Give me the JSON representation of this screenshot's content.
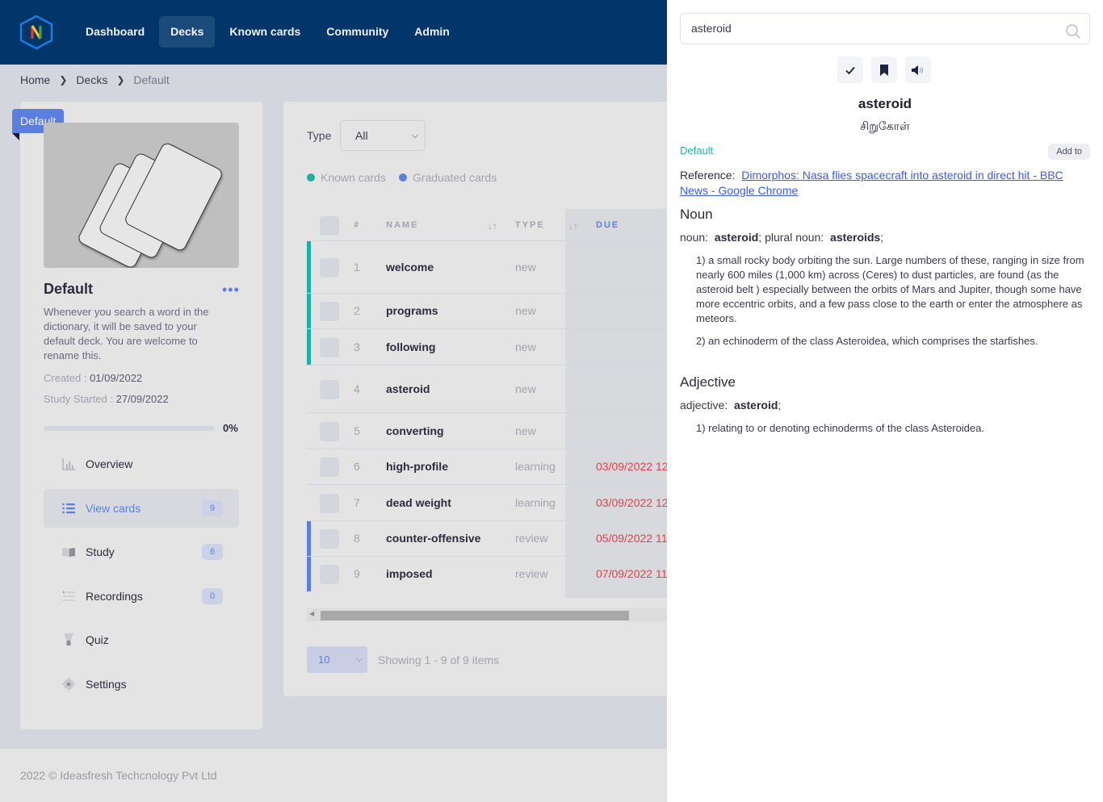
{
  "nav": {
    "logo_letter": "N",
    "items": [
      {
        "label": "Dashboard",
        "active": false
      },
      {
        "label": "Decks",
        "active": true
      },
      {
        "label": "Known cards",
        "active": false
      },
      {
        "label": "Community",
        "active": false
      },
      {
        "label": "Admin",
        "active": false
      }
    ]
  },
  "breadcrumb": [
    "Home",
    "Decks",
    "Default"
  ],
  "deck": {
    "ribbon": "Default",
    "title": "Default",
    "more_icon": "ellipsis-icon",
    "description": "Whenever you search a word in the dictionary, it will be saved to your default deck. You are welcome to rename this.",
    "created_label": "Created : ",
    "created": "01/09/2022",
    "study_started_label": "Study Started : ",
    "study_started": "27/09/2022",
    "progress_percent": 0,
    "progress_label": "0%",
    "menu": [
      {
        "label": "Overview",
        "icon": "bar-chart-icon",
        "badge": null,
        "active": false
      },
      {
        "label": "View cards",
        "icon": "list-icon",
        "badge": "9",
        "active": true
      },
      {
        "label": "Study",
        "icon": "book-icon",
        "badge": "6",
        "active": false
      },
      {
        "label": "Recordings",
        "icon": "playlist-icon",
        "badge": "0",
        "active": false
      },
      {
        "label": "Quiz",
        "icon": "trophy-icon",
        "badge": null,
        "active": false
      },
      {
        "label": "Settings",
        "icon": "gear-icon",
        "badge": null,
        "active": false
      }
    ]
  },
  "cards": {
    "filter_label": "Type",
    "filter_value": "All",
    "legend": [
      {
        "label": "Known cards",
        "color": "#1bb0a2"
      },
      {
        "label": "Graduated cards",
        "color": "#5b7fe0"
      }
    ],
    "columns": [
      "#",
      "NAME",
      "TYPE",
      "DUE"
    ],
    "rows": [
      {
        "num": "1",
        "name": "welcome",
        "type": "new",
        "due": "",
        "marker": "known"
      },
      {
        "num": "2",
        "name": "programs",
        "type": "new",
        "due": "",
        "marker": "known"
      },
      {
        "num": "3",
        "name": "following",
        "type": "new",
        "due": "",
        "marker": "known"
      },
      {
        "num": "4",
        "name": "asteroid",
        "type": "new",
        "due": "",
        "marker": ""
      },
      {
        "num": "5",
        "name": "converting",
        "type": "new",
        "due": "",
        "marker": ""
      },
      {
        "num": "6",
        "name": "high-profile",
        "type": "learning",
        "due": "03/09/2022 12",
        "marker": ""
      },
      {
        "num": "7",
        "name": "dead weight",
        "type": "learning",
        "due": "03/09/2022 12",
        "marker": ""
      },
      {
        "num": "8",
        "name": "counter-offensive",
        "type": "review",
        "due": "05/09/2022 11",
        "marker": "graduated"
      },
      {
        "num": "9",
        "name": "imposed",
        "type": "review",
        "due": "07/09/2022 11",
        "marker": "graduated"
      }
    ],
    "page_size": "10",
    "showing": "Showing 1 - 9 of 9 items"
  },
  "footer": "2022 © Ideasfresh Techcnology Pvt Ltd",
  "dictionary": {
    "search_value": "asteroid",
    "actions": [
      "check-icon",
      "bookmark-icon",
      "speaker-icon"
    ],
    "word": "asteroid",
    "translation": "சிறுகோள்",
    "deck": "Default",
    "add_to": "Add to",
    "reference_label": "Reference:",
    "reference_link": "Dimorphos: Nasa flies spacecraft into asteroid in direct hit - BBC News - Google Chrome",
    "sections": [
      {
        "pos": "Noun",
        "forms_prefix": "noun:",
        "form1": "asteroid",
        "forms_mid": "; plural noun:",
        "form2": "asteroids",
        "definitions": [
          "1)  a small rocky body orbiting the sun. Large numbers of these, ranging in size from nearly 600 miles (1,000 km) across (Ceres) to dust particles, are found (as the asteroid belt ) especially between the orbits of Mars and Jupiter, though some have more eccentric orbits, and a few pass close to the earth or enter the atmosphere as meteors.",
          "2)  an echinoderm of the class Asteroidea, which comprises the starfishes."
        ]
      },
      {
        "pos": "Adjective",
        "forms_prefix": "adjective:",
        "form1": "asteroid",
        "definitions": [
          "1)  relating to or denoting echinoderms of the class Asteroidea."
        ]
      }
    ]
  }
}
